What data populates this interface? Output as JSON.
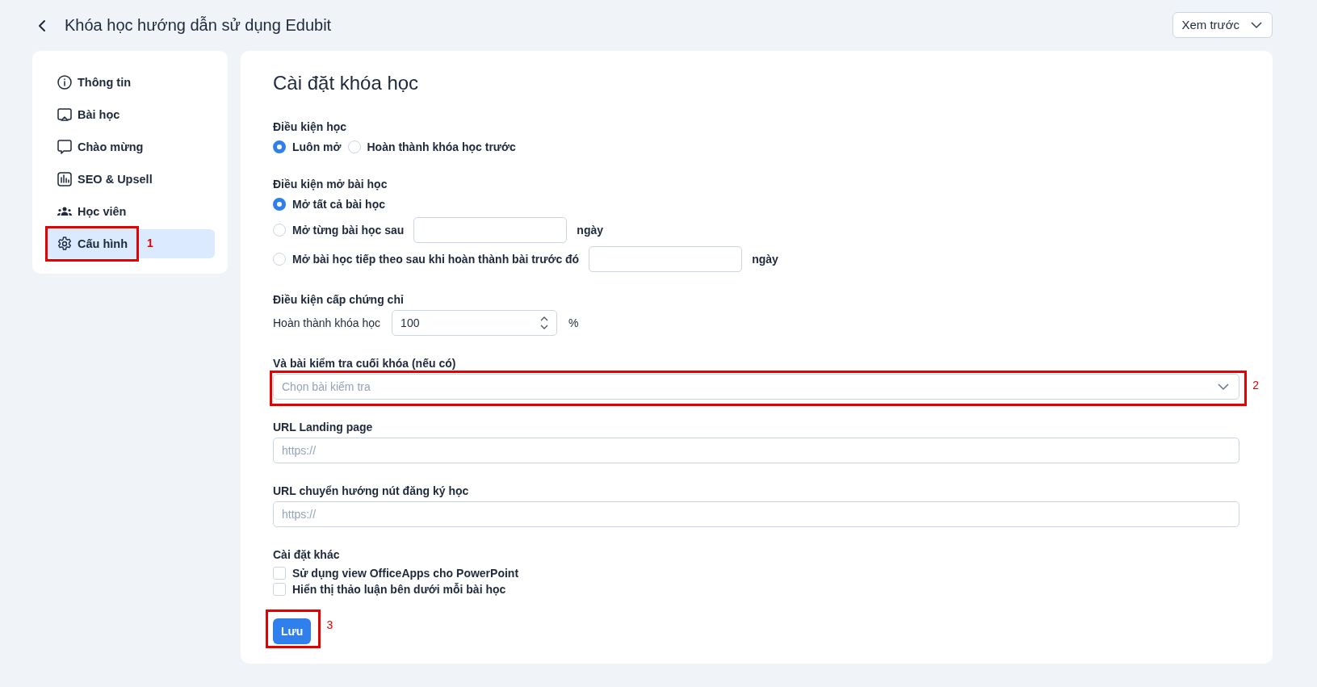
{
  "header": {
    "title": "Khóa học hướng dẫn sử dụng Edubit",
    "preview_button": "Xem trước"
  },
  "sidebar": {
    "items": [
      {
        "label": "Thông tin",
        "kind": "info",
        "selected": false
      },
      {
        "label": "Bài học",
        "kind": "lesson",
        "selected": false
      },
      {
        "label": "Chào mừng",
        "kind": "welcome",
        "selected": false
      },
      {
        "label": "SEO & Upsell",
        "kind": "seo",
        "selected": false
      },
      {
        "label": "Học viên",
        "kind": "students",
        "selected": false
      },
      {
        "label": "Cấu hình",
        "kind": "settings",
        "selected": true,
        "annotation": "1"
      }
    ]
  },
  "settings": {
    "title": "Cài đặt khóa học",
    "study_condition": {
      "label": "Điều kiện học",
      "options": [
        {
          "label": "Luôn mở",
          "selected": true
        },
        {
          "label": "Hoàn thành khóa học trước",
          "selected": false
        }
      ]
    },
    "unlock_condition": {
      "label": "Điều kiện mở bài học",
      "options": [
        {
          "label": "Mở tất cả bài học",
          "selected": true,
          "kind": "plain"
        },
        {
          "label": "Mở từng bài học sau",
          "selected": false,
          "kind": "days",
          "unit": "ngày"
        },
        {
          "label": "Mở bài học tiếp theo sau khi hoàn thành bài trước đó",
          "selected": false,
          "kind": "days",
          "unit": "ngày"
        }
      ]
    },
    "certificate": {
      "label": "Điều kiện cấp chứng chỉ",
      "field_label": "Hoàn thành khóa học",
      "value": "100",
      "unit": "%"
    },
    "final_test": {
      "label": "Và bài kiểm tra cuối khóa (nếu có)",
      "placeholder": "Chọn bài kiểm tra",
      "annotation": "2"
    },
    "landing_url": {
      "label": "URL Landing page",
      "placeholder": "https://"
    },
    "redirect_url": {
      "label": "URL chuyển hướng nút đăng ký học",
      "placeholder": "https://"
    },
    "other": {
      "label": "Cài đặt khác",
      "options": [
        {
          "label": "Sử dụng view OfficeApps cho PowerPoint",
          "checked": false
        },
        {
          "label": "Hiển thị thảo luận bên dưới mỗi bài học",
          "checked": false
        }
      ]
    },
    "save_button": {
      "label": "Lưu",
      "annotation": "3"
    }
  }
}
